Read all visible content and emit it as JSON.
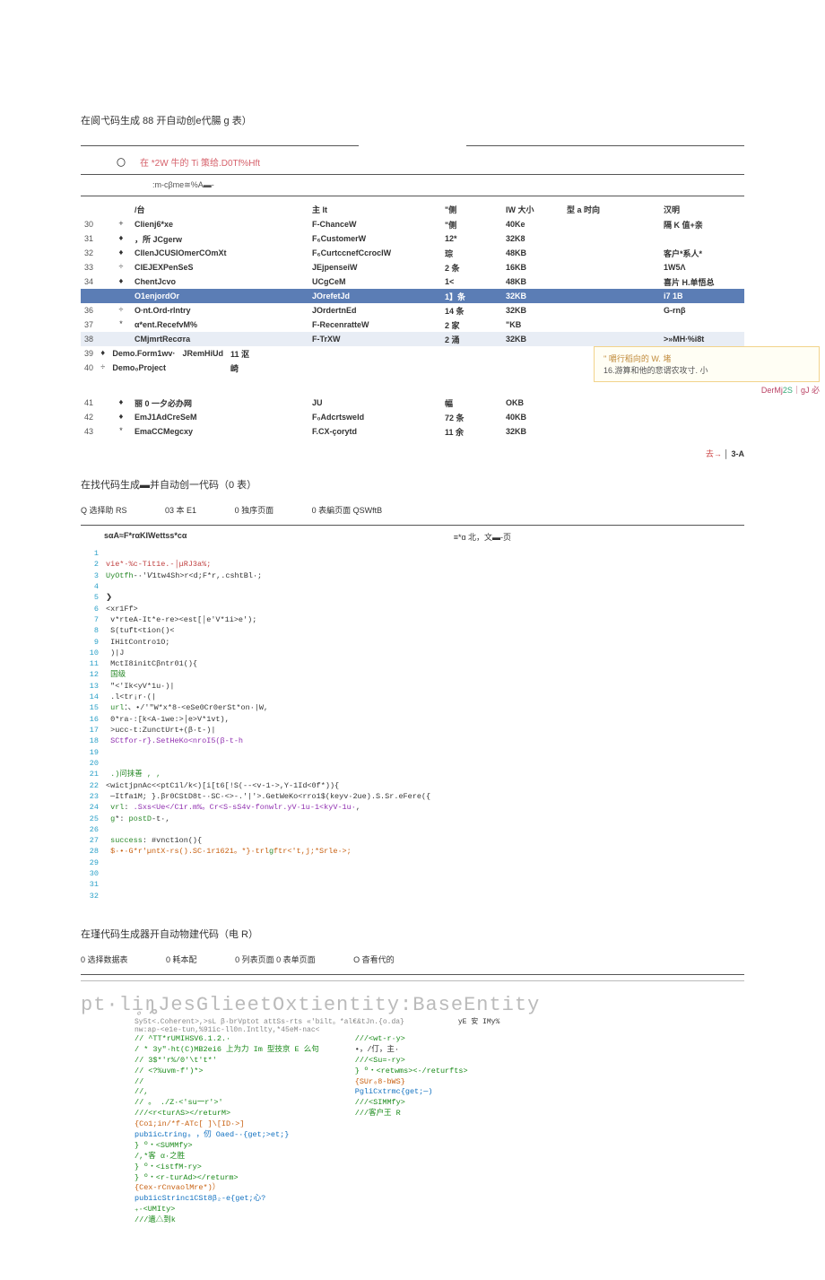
{
  "section1": {
    "title": "在阆弋码生成 88 开自动创e代腸 g 表）",
    "sub1": "在 *2W 牛的 Ti 策给.D0Tf%Hft",
    "sub2": ":m-cβme≅%A▬-",
    "headers": [
      "/台",
      "主 It",
      "\"侧",
      "IW 大小",
      "型 a 时向",
      "汉明"
    ],
    "rows": [
      {
        "idx": "30",
        "icon": "+",
        "name": "Clienj6*xe",
        "type": "F-ChanceW",
        "col": "\"侧",
        "size": "40Ke",
        "time": "",
        "desc": "隔 K 值+亲"
      },
      {
        "idx": "31",
        "icon": "♦",
        "name": "，所 JCgerw",
        "type": "F₆CustomerW",
        "col": "12*",
        "size": "32K8",
        "time": "",
        "desc": ""
      },
      {
        "idx": "32",
        "icon": "♦",
        "name": "CllenJCUSIOmerCOmXt",
        "type": "F₆CurtccnefCcrocIW",
        "col": "琮",
        "size": "48KB",
        "time": "",
        "desc": "客户*系人*"
      },
      {
        "idx": "33",
        "icon": "÷",
        "name": "ClEJEXPenSeS",
        "type": "JEjpenseiW",
        "col": "2 条",
        "size": "16KB",
        "time": "",
        "desc": "1W5Λ"
      },
      {
        "idx": "34",
        "icon": "♦",
        "name": "ChentJcvo<e",
        "type": "UCgCeM",
        "col": "1<",
        "size": "48KB",
        "time": "",
        "desc": "喜片 H.单悟总"
      },
      {
        "idx": "",
        "icon": "",
        "name": "O1enjordOr",
        "type": "JOrefetJd",
        "col": "1】条",
        "size": "32KB",
        "time": "",
        "desc": "i7 1B",
        "sel": true
      },
      {
        "idx": "36",
        "icon": "÷",
        "name": "O∙nt.Ord-rlntry",
        "type": "JOrdertnEd",
        "col": "14 条",
        "size": "32KB",
        "time": "",
        "desc": "G-rnβ"
      },
      {
        "idx": "37",
        "icon": "*",
        "name": "α*ent.RecefvM%",
        "type": "F-RecenratteW",
        "col": "2 家",
        "size": "\"KB",
        "time": "",
        "desc": ""
      },
      {
        "idx": "38",
        "icon": "",
        "name": "CMjmrtRecσra",
        "type": "F-TrXW",
        "col": "2 涌",
        "size": "32KB",
        "time": "",
        "desc": ">»MH∙%i8t",
        "sel2": true
      }
    ],
    "tooltip1": "'' 嚼行稻向的 W. 堵",
    "tooltip2": "16.游算和他的悲谓农攻寸. 小",
    "rows2": [
      {
        "idx": "39",
        "icon": "♦",
        "name": "Demo.Form1wv·",
        "type": "JRemHiUd",
        "col": "11 沤",
        "size": "",
        "time": "",
        "desc": ""
      },
      {
        "idx": "40",
        "icon": "÷",
        "name": "Demo₀Project",
        "type": "",
        "col": "崎",
        "size": "",
        "time": "",
        "desc": ""
      },
      {
        "idx": "41",
        "icon": "♦",
        "name": "丽 0 一夕必办网",
        "type": "JU",
        "col": "幅",
        "size": "OKB",
        "time": "",
        "desc": ""
      },
      {
        "idx": "42",
        "icon": "♦",
        "name": "EmJ1AdCreSeM",
        "type": "F₀Adcrtsweld",
        "col": "72 条",
        "size": "40KB",
        "time": "",
        "desc": ""
      },
      {
        "idx": "43",
        "icon": "*",
        "name": "EmaCCMegcxy",
        "type": "F.CX-çorytd",
        "col": "11 余",
        "size": "32KB",
        "time": "",
        "desc": ""
      }
    ],
    "after_tip": {
      "l": "",
      "r1": "DerMj",
      "r2": "2S",
      "r3": "gJ 必"
    },
    "page": "去→ │ 3-A"
  },
  "section2": {
    "title": "在找代码生成▬并自动创一代码（0 表）",
    "steps": [
      "Q 选择助 RS",
      "03 本 E1",
      "0 独序页面",
      "0 表編页面 QSWftB"
    ],
    "leftbold": "sαA≈F*rαKIWettss*cα",
    "rightnote": "≡*ɑ 北，文▬-页",
    "code": [
      [
        "",
        ""
      ],
      [
        "",
        "vie*∙%c-Tit1e.-│μRJ3a%;"
      ],
      [
        "",
        "UyOtfh-·'𝘝1tw4Sh>r<d;F*r,.cshtBl·;"
      ],
      [
        "",
        ""
      ],
      [
        "",
        "❯"
      ],
      [
        "",
        "<xr1Ff>"
      ],
      [
        "",
        "   v*rteA-It*e-re><est[│e'V*1i>e');"
      ],
      [
        "",
        "   S(tuft<tion()<"
      ],
      [
        "",
        "      IHitContro1O;"
      ],
      [
        "",
        "   )|J"
      ],
      [
        "",
        "   MctI8initCβntr01(){"
      ],
      [
        "",
        "      国级"
      ],
      [
        "",
        "      \"<'Ik<yV*1u·)|"
      ],
      [
        "",
        "         .l<tr¡r·(|"
      ],
      [
        "",
        "            url：、•/'\"W*x*8-<eSe0Cr0erSt*on·|W,"
      ],
      [
        "",
        "            0*ra-:[k<A-1we:>│e>V*1vt),"
      ],
      [
        "",
        "            >ucc-t:ZunctUrt+(β·t-)|"
      ],
      [
        "",
        "               SCtfor-r}.SetHeKo<nroI5(β-t-h"
      ],
      [
        "",
        ""
      ],
      [
        "",
        ""
      ],
      [
        "",
        "   .)问抹善 , ,"
      ],
      [
        "",
        "<wictjpnAc<<ptC1l/k<)[i[t6[!S(--<v-1->,Y-1Id<0f*)){"
      ],
      [
        "",
        "   ─Itfa1M;   }.βr0CStD8t-·SC·<>-.'|'>.GetWeKo<rro1$(keyv·2ue).S.Sr.eFere({"
      ],
      [
        "",
        "      vrl:         .Sxs<Ue</C1r.m%。Cr<S-sS4v-fonwlr.yV·1u-1<kyV-1u·,"
      ],
      [
        "",
        "      g*:  postD-t·,"
      ],
      [
        "",
        ""
      ],
      [
        "",
        "      success: #vnct1on(){"
      ],
      [
        "",
        "         $·•·G*r'µntX-rs().SC·1r1621。*}·trlgftr<'t,j;*Srle·>;"
      ],
      [
        "",
        ""
      ],
      [
        "",
        ""
      ],
      [
        "",
        ""
      ],
      [
        "",
        ""
      ]
    ]
  },
  "section3": {
    "title": "在瑾代码生成器开自动物建代码（电 R）",
    "steps": [
      "0 选择数据表",
      "0 耗本配",
      "0 列表页面 0 表单页面",
      "O 杳看代的"
    ],
    "bighead": "pt·liᤲȵJesGlieetOxtientity:BaseEntity",
    "subhead1": "Sy5t<.Coherent>,>sL   β·brVptot   attSs-rts  «'bilt。*al€&tJn.{o.da}",
    "subhead2": "nw:ap-<e1e-tun,%91ic-ll0n.Intlty,*45eM-nac<",
    "subhead_r": "yE 安 IMy%",
    "col1": [
      "// ^TT*rUMIHSV6.1.2.·",
      "/ *  3y\"·ht(C)MB2ei6 上为力 Im 型技京 E 么句",
      "//  3$*'r%/0'\\t't*'",
      "//  <?%uvm-f')*>",
      "//",
      "//,",
      "// 。              ./Z·<'su一r'>'",
      "///<r<turΛS></returM>",
      "{Co1;in/*f-ATc[ ]\\[ID·>]",
      "pub1icᤱtring₀  ，仞 Oaed-·{get;>et;}",
      "} º・<SUMMfy>",
      "/,*客 α·之胜",
      "} º・<istfM-ry>",
      "} º・<r-turAd></returm>",
      "{Cex-rCnvaolMre*)）",
      "pub1icStrinc1CSt8β₂-e{get;心?",
      "₊·<UMIty>",
      "///遺△到k"
    ],
    "col2": [
      "///<wt-r·y>",
      " •，/仃，主·",
      "///<Su=-ry>",
      "} º・<retwms><∙/returfts>",
      "{SUr₀8-bWS}",
      "PgliCxtrmc{get;─)",
      "///<SIMMfy>",
      "///客户王 R"
    ]
  }
}
